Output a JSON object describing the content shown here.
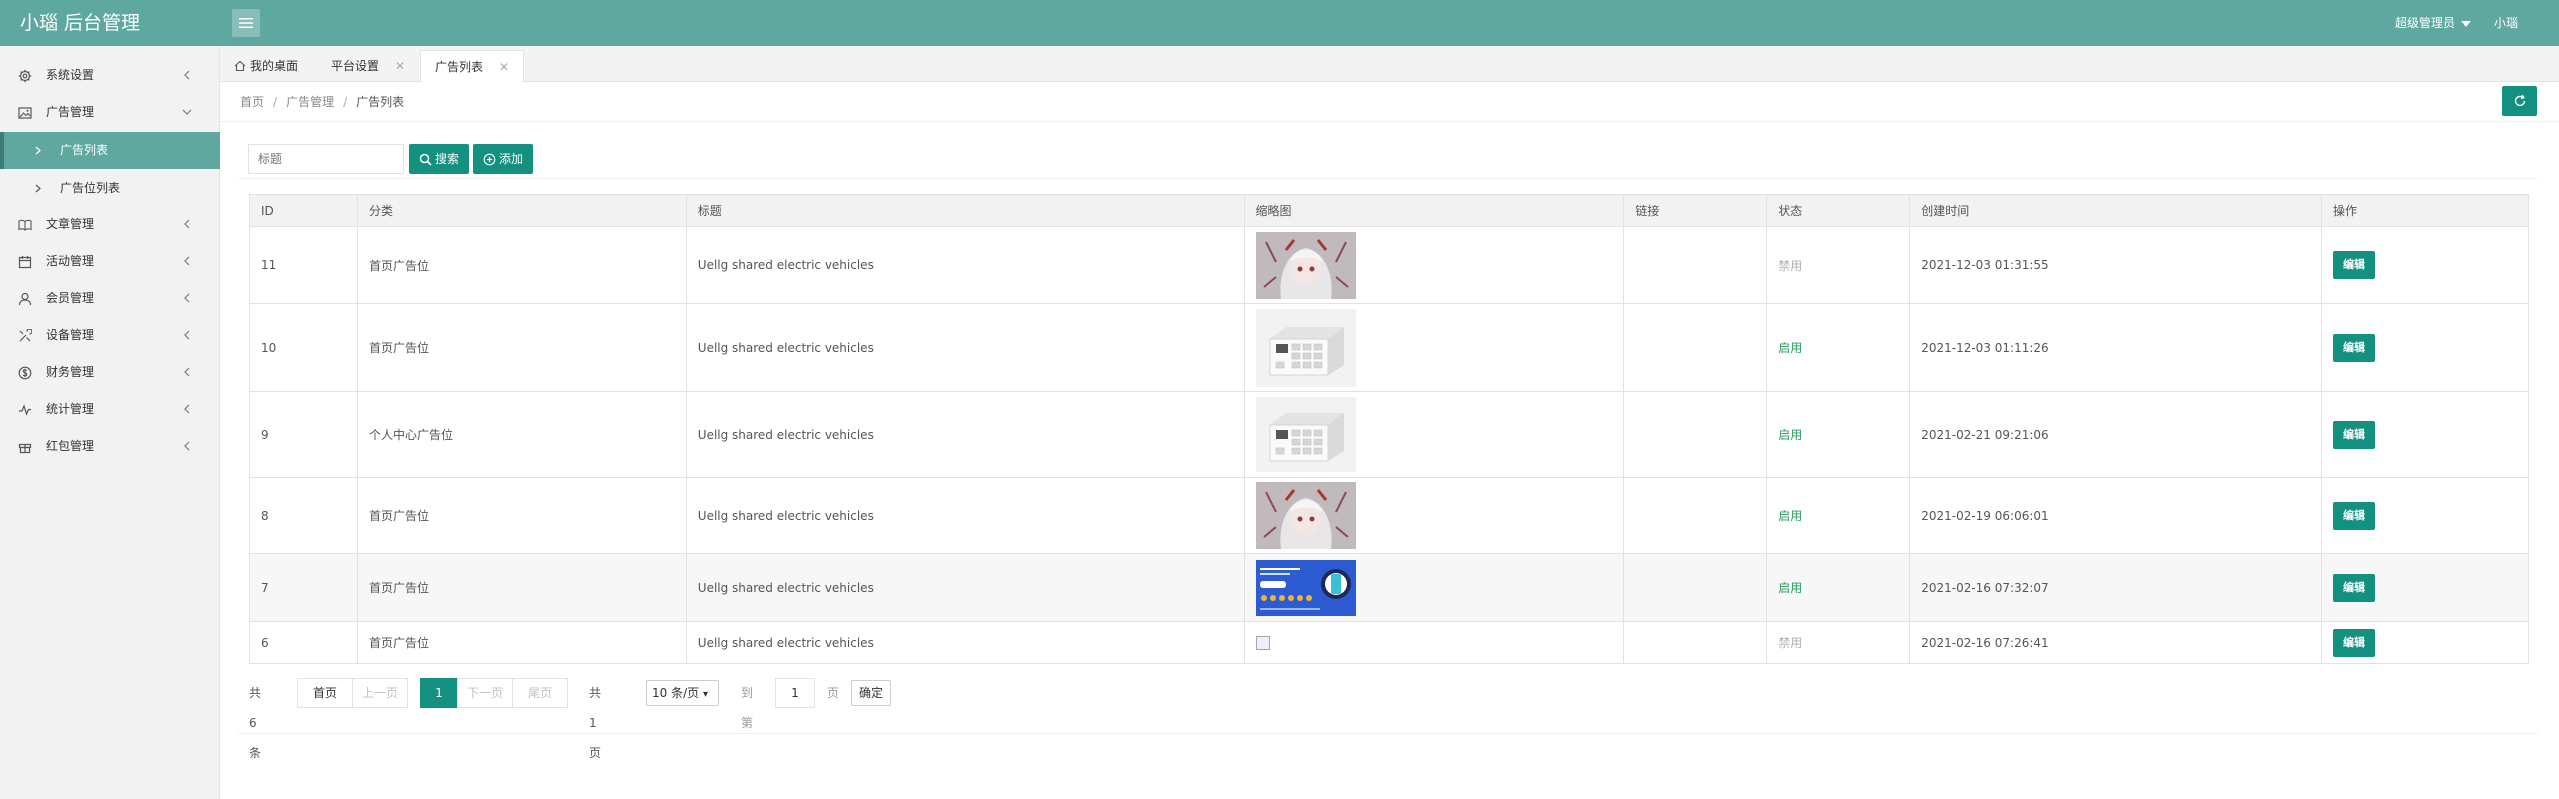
{
  "header": {
    "logo": "小瑙 后台管理",
    "user_role": "超级管理员",
    "user_name": "小瑙"
  },
  "sidebar": {
    "items": [
      {
        "label": "系统设置",
        "icon": "gear-icon",
        "expanded": false
      },
      {
        "label": "广告管理",
        "icon": "image-icon",
        "expanded": true
      },
      {
        "label": "文章管理",
        "icon": "book-icon",
        "expanded": false
      },
      {
        "label": "活动管理",
        "icon": "calendar-icon",
        "expanded": false
      },
      {
        "label": "会员管理",
        "icon": "user-icon",
        "expanded": false
      },
      {
        "label": "设备管理",
        "icon": "tools-icon",
        "expanded": false
      },
      {
        "label": "财务管理",
        "icon": "dollar-icon",
        "expanded": false
      },
      {
        "label": "统计管理",
        "icon": "chart-icon",
        "expanded": false
      },
      {
        "label": "红包管理",
        "icon": "gift-icon",
        "expanded": false
      }
    ],
    "subitems": [
      {
        "label": "广告列表",
        "active": true
      },
      {
        "label": "广告位列表",
        "active": false
      }
    ]
  },
  "tabs": [
    {
      "label": "我的桌面"
    },
    {
      "label": "平台设置"
    },
    {
      "label": "广告列表"
    }
  ],
  "breadcrumb": [
    "首页",
    "广告管理",
    "广告列表"
  ],
  "toolbar": {
    "search_placeholder": "标题",
    "search_label": "搜索",
    "add_label": "添加"
  },
  "table": {
    "columns": [
      "ID",
      "分类",
      "标题",
      "缩略图",
      "链接",
      "状态",
      "创建时间",
      "操作"
    ],
    "rows": [
      {
        "id": "11",
        "category": "首页广告位",
        "title": "Uellg shared electric vehicles",
        "thumb": "anime-girl-image",
        "link": "",
        "status": "禁用",
        "created": "2021-12-03 01:31:55",
        "action": "编辑"
      },
      {
        "id": "10",
        "category": "首页广告位",
        "title": "Uellg shared electric vehicles",
        "thumb": "charging-cabinet-image",
        "link": "",
        "status": "启用",
        "created": "2021-12-03 01:11:26",
        "action": "编辑"
      },
      {
        "id": "9",
        "category": "个人中心广告位",
        "title": "Uellg shared electric vehicles",
        "thumb": "charging-cabinet-image",
        "link": "",
        "status": "启用",
        "created": "2021-02-21 09:21:06",
        "action": "编辑"
      },
      {
        "id": "8",
        "category": "首页广告位",
        "title": "Uellg shared electric vehicles",
        "thumb": "anime-girl-image",
        "link": "",
        "status": "启用",
        "created": "2021-02-19 06:06:01",
        "action": "编辑"
      },
      {
        "id": "7",
        "category": "首页广告位",
        "title": "Uellg shared electric vehicles",
        "thumb": "blue-banner-image",
        "link": "",
        "status": "启用",
        "created": "2021-02-16 07:32:07",
        "action": "编辑"
      },
      {
        "id": "6",
        "category": "首页广告位",
        "title": "Uellg shared electric vehicles",
        "thumb": "broken-image",
        "link": "",
        "status": "禁用",
        "created": "2021-02-16 07:26:41",
        "action": "编辑"
      }
    ]
  },
  "pagination": {
    "total_text": "共 6 条",
    "first": "首页",
    "prev": "上一页",
    "current": "1",
    "next": "下一页",
    "last": "尾页",
    "pages_text": "共 1 页",
    "page_size": "10 条/页",
    "goto_label": "到第",
    "goto_value": "1",
    "page_unit": "页",
    "confirm": "确定"
  },
  "colors": {
    "header": "#5fa8a0",
    "primary": "#13907f",
    "enabled": "#2a9d5c",
    "disabled": "#b0b0b0"
  }
}
